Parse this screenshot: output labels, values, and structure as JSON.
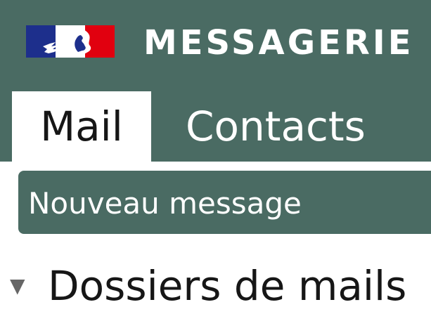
{
  "header": {
    "title": "MESSAGERIE",
    "logo_icon": "marianne-logo-icon"
  },
  "tabs": [
    {
      "label": "Mail",
      "active": true
    },
    {
      "label": "Contacts",
      "active": false
    }
  ],
  "toolbar": {
    "new_message_label": "Nouveau message"
  },
  "folders": {
    "label": "Dossiers de mails",
    "toggle_icon": "triangle-down-icon",
    "expanded": true
  },
  "colors": {
    "header_bg": "#4a6b63",
    "flag_blue": "#1d2f8c",
    "flag_red": "#e1000f"
  }
}
